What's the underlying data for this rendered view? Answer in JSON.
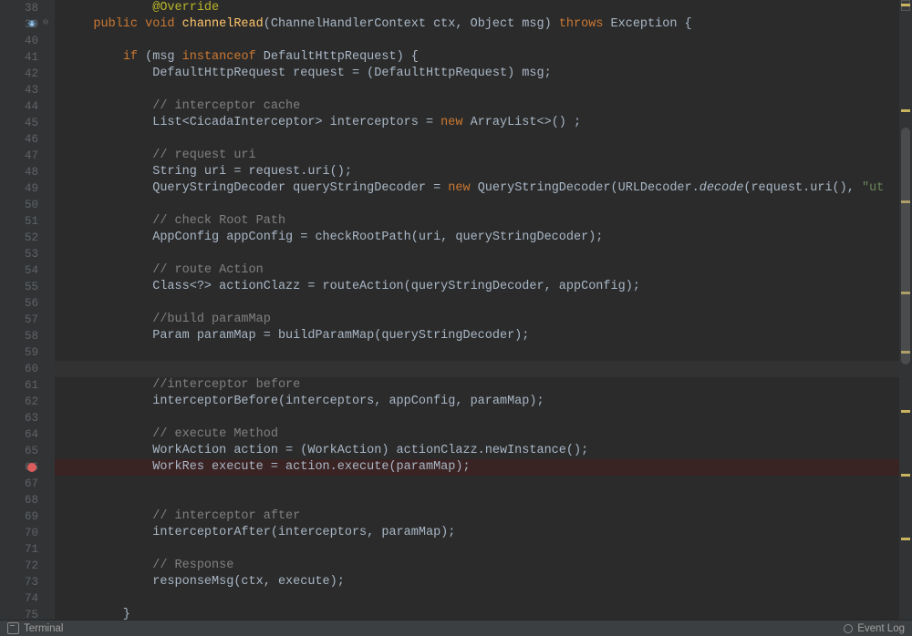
{
  "statusbar": {
    "terminal": "Terminal",
    "eventlog": "Event Log"
  },
  "gutter": {
    "override_line": 39,
    "fold_line": 39,
    "breakpoint_line": 66,
    "caret_line": 60
  },
  "lines": [
    {
      "n": 38,
      "seg": [
        [
          "            ",
          "txt"
        ],
        [
          "@Override",
          "ann"
        ]
      ]
    },
    {
      "n": 39,
      "seg": [
        [
          "    ",
          "txt"
        ],
        [
          "public void ",
          "kw"
        ],
        [
          "channelRead",
          "mdecl"
        ],
        [
          "(ChannelHandlerContext ctx, Object msg) ",
          "txt"
        ],
        [
          "throws ",
          "kw"
        ],
        [
          "Exception {",
          "txt"
        ]
      ]
    },
    {
      "n": 40,
      "seg": [
        [
          "",
          "txt"
        ]
      ]
    },
    {
      "n": 41,
      "seg": [
        [
          "        ",
          "txt"
        ],
        [
          "if ",
          "kw"
        ],
        [
          "(msg ",
          "txt"
        ],
        [
          "instanceof ",
          "kw"
        ],
        [
          "DefaultHttpRequest) {",
          "txt"
        ]
      ]
    },
    {
      "n": 42,
      "seg": [
        [
          "            DefaultHttpRequest request = (DefaultHttpRequest) msg;",
          "txt"
        ]
      ]
    },
    {
      "n": 43,
      "seg": [
        [
          "",
          "txt"
        ]
      ]
    },
    {
      "n": 44,
      "seg": [
        [
          "            ",
          "txt"
        ],
        [
          "// interceptor cache",
          "cmt"
        ]
      ]
    },
    {
      "n": 45,
      "seg": [
        [
          "            List<CicadaInterceptor> interceptors = ",
          "txt"
        ],
        [
          "new ",
          "kw"
        ],
        [
          "ArrayList<>() ;",
          "txt"
        ]
      ]
    },
    {
      "n": 46,
      "seg": [
        [
          "",
          "txt"
        ]
      ]
    },
    {
      "n": 47,
      "seg": [
        [
          "            ",
          "txt"
        ],
        [
          "// request uri",
          "cmt"
        ]
      ]
    },
    {
      "n": 48,
      "seg": [
        [
          "            String uri = request.uri();",
          "txt"
        ]
      ]
    },
    {
      "n": 49,
      "seg": [
        [
          "            QueryStringDecoder queryStringDecoder = ",
          "txt"
        ],
        [
          "new ",
          "kw"
        ],
        [
          "QueryStringDecoder(URLDecoder.",
          "txt"
        ],
        [
          "decode",
          "ital"
        ],
        [
          "(request.uri(), ",
          "txt"
        ],
        [
          "\"ut",
          "str"
        ]
      ]
    },
    {
      "n": 50,
      "seg": [
        [
          "",
          "txt"
        ]
      ]
    },
    {
      "n": 51,
      "seg": [
        [
          "            ",
          "txt"
        ],
        [
          "// check Root Path",
          "cmt"
        ]
      ]
    },
    {
      "n": 52,
      "seg": [
        [
          "            AppConfig appConfig = checkRootPath(uri, queryStringDecoder);",
          "txt"
        ]
      ]
    },
    {
      "n": 53,
      "seg": [
        [
          "",
          "txt"
        ]
      ]
    },
    {
      "n": 54,
      "seg": [
        [
          "            ",
          "txt"
        ],
        [
          "// route Action",
          "cmt"
        ]
      ]
    },
    {
      "n": 55,
      "seg": [
        [
          "            Class<?> actionClazz = routeAction(queryStringDecoder, appConfig);",
          "txt"
        ]
      ]
    },
    {
      "n": 56,
      "seg": [
        [
          "",
          "txt"
        ]
      ]
    },
    {
      "n": 57,
      "seg": [
        [
          "            ",
          "txt"
        ],
        [
          "//build paramMap",
          "cmt"
        ]
      ]
    },
    {
      "n": 58,
      "seg": [
        [
          "            Param paramMap = buildParamMap(queryStringDecoder);",
          "txt"
        ]
      ]
    },
    {
      "n": 59,
      "seg": [
        [
          "",
          "txt"
        ]
      ]
    },
    {
      "n": 60,
      "seg": [
        [
          "",
          "txt"
        ]
      ]
    },
    {
      "n": 61,
      "seg": [
        [
          "            ",
          "txt"
        ],
        [
          "//interceptor before",
          "cmt"
        ]
      ]
    },
    {
      "n": 62,
      "seg": [
        [
          "            interceptorBefore(interceptors, appConfig, paramMap);",
          "txt"
        ]
      ]
    },
    {
      "n": 63,
      "seg": [
        [
          "",
          "txt"
        ]
      ]
    },
    {
      "n": 64,
      "seg": [
        [
          "            ",
          "txt"
        ],
        [
          "// execute Method",
          "cmt"
        ]
      ]
    },
    {
      "n": 65,
      "seg": [
        [
          "            WorkAction action = (WorkAction) actionClazz.newInstance();",
          "txt"
        ]
      ]
    },
    {
      "n": 66,
      "seg": [
        [
          "            WorkRes execute = action.execute(paramMap);",
          "txt"
        ]
      ]
    },
    {
      "n": 67,
      "seg": [
        [
          "",
          "txt"
        ]
      ]
    },
    {
      "n": 68,
      "seg": [
        [
          "",
          "txt"
        ]
      ]
    },
    {
      "n": 69,
      "seg": [
        [
          "            ",
          "txt"
        ],
        [
          "// interceptor after",
          "cmt"
        ]
      ]
    },
    {
      "n": 70,
      "seg": [
        [
          "            interceptorAfter(interceptors, paramMap);",
          "txt"
        ]
      ]
    },
    {
      "n": 71,
      "seg": [
        [
          "",
          "txt"
        ]
      ]
    },
    {
      "n": 72,
      "seg": [
        [
          "            ",
          "txt"
        ],
        [
          "// Response",
          "cmt"
        ]
      ]
    },
    {
      "n": 73,
      "seg": [
        [
          "            responseMsg(ctx, execute);",
          "txt"
        ]
      ]
    },
    {
      "n": 74,
      "seg": [
        [
          "",
          "txt"
        ]
      ]
    },
    {
      "n": 75,
      "seg": [
        [
          "        }",
          "txt"
        ]
      ]
    }
  ],
  "stripe_marks": [
    4,
    120,
    220,
    320,
    385,
    450,
    520,
    590
  ]
}
